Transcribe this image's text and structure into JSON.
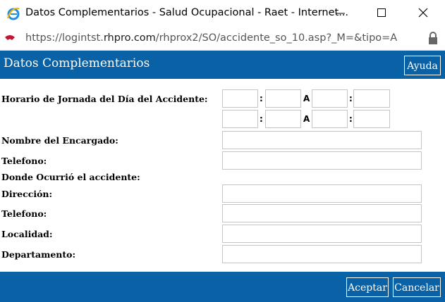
{
  "window": {
    "title": "Datos Complementarios - Salud Ocupacional - Raet - Internet...",
    "icons": [
      "internet-explorer-icon",
      "minimize-icon",
      "maximize-icon",
      "close-icon"
    ]
  },
  "address": {
    "url_prefix": "https://logintst.",
    "url_domain": "rhpro.com",
    "url_path": "/rhprox2/SO/accidente_so_10.asp?_M=&tipo=A",
    "site_icon": "rhpro-logo-icon",
    "lock_icon": "lock-icon"
  },
  "header": {
    "title": "Datos Complementarios",
    "help_label": "Ayuda"
  },
  "form": {
    "horario_label": "Horario de Jornada del Día del Accidente:",
    "colon": ":",
    "a_sep": "A",
    "horario_row1": {
      "h1": "",
      "m1": "",
      "h2": "",
      "m2": ""
    },
    "horario_row2": {
      "h1": "",
      "m1": "",
      "h2": "",
      "m2": ""
    },
    "encargado_label": "Nombre del Encargado:",
    "encargado_value": "",
    "telefono1_label": "Telefono:",
    "telefono1_value": "",
    "donde_label": "Donde Ocurrió el accidente:",
    "direccion_label": "Dirección:",
    "direccion_value": "",
    "telefono2_label": "Telefono:",
    "telefono2_value": "",
    "localidad_label": "Localidad:",
    "localidad_value": "",
    "departamento_label": "Departamento:",
    "departamento_value": ""
  },
  "footer": {
    "accept_label": "Aceptar",
    "cancel_label": "Cancelar"
  },
  "colors": {
    "brand_blue": "#0962a6",
    "field_border": "#c5c5c5"
  }
}
